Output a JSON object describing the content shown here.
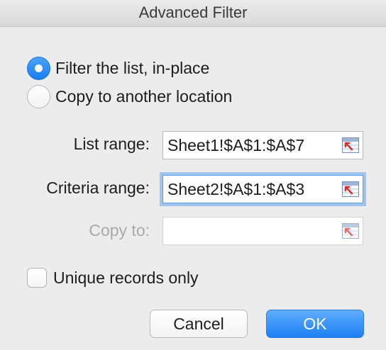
{
  "dialog": {
    "title": "Advanced Filter"
  },
  "action": {
    "options": [
      {
        "label": "Filter the list, in-place",
        "selected": true
      },
      {
        "label": "Copy to another location",
        "selected": false
      }
    ]
  },
  "fields": {
    "list_range": {
      "label": "List range:",
      "value": "Sheet1!$A$1:$A$7"
    },
    "criteria_range": {
      "label": "Criteria range:",
      "value": "Sheet2!$A$1:$A$3"
    },
    "copy_to": {
      "label": "Copy to:",
      "value": "",
      "disabled": true
    }
  },
  "unique": {
    "label": "Unique records only",
    "checked": false
  },
  "buttons": {
    "cancel": "Cancel",
    "ok": "OK"
  },
  "colors": {
    "accent": "#1a7cf0",
    "focus_ring": "#9ec5f0",
    "disabled_text": "#a9a9a9"
  },
  "icons": {
    "range_picker": "range-picker-icon"
  }
}
